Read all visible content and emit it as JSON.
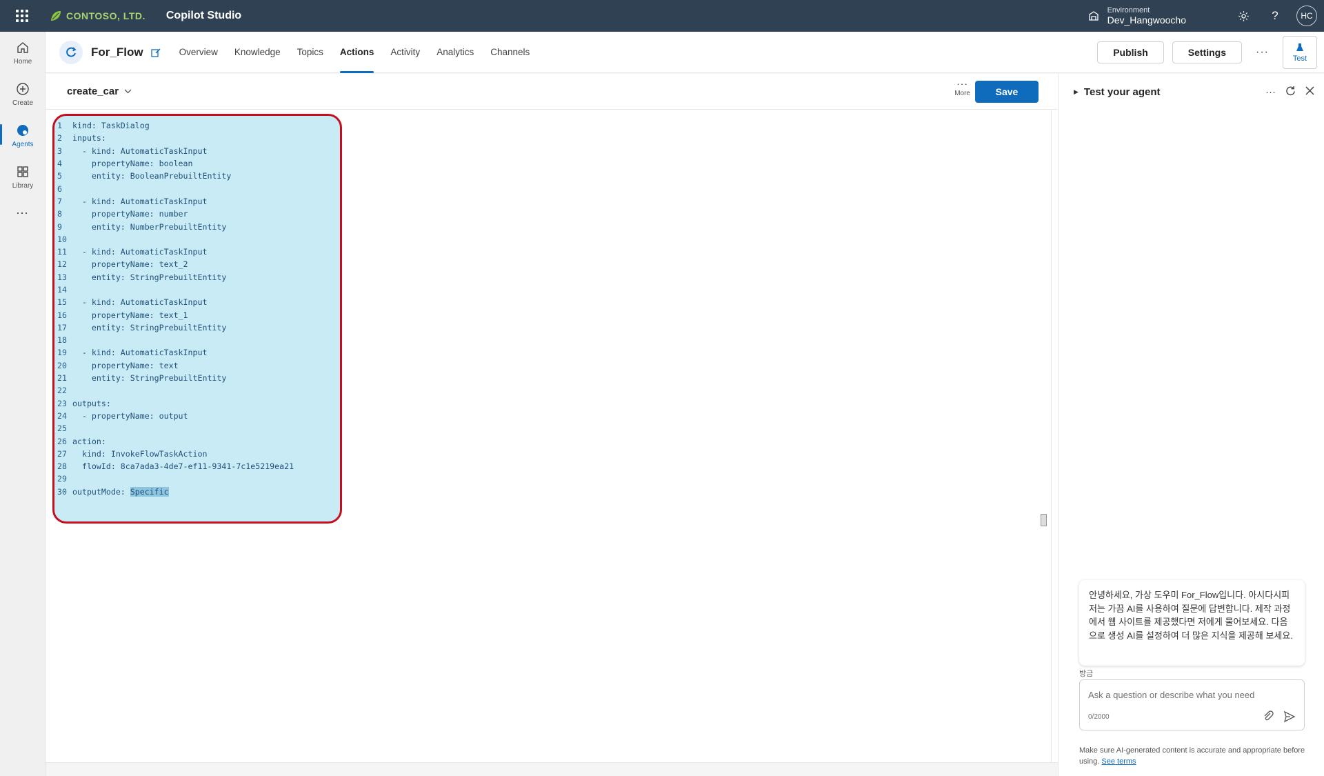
{
  "topbar": {
    "brand": "CONTOSO, LTD.",
    "app_title": "Copilot Studio",
    "environment_label": "Environment",
    "environment_value": "Dev_Hangwoocho",
    "avatar_initials": "HC"
  },
  "rail": {
    "items": [
      {
        "label": "Home",
        "icon": "home-icon"
      },
      {
        "label": "Create",
        "icon": "plus-circle-icon"
      },
      {
        "label": "Agents",
        "icon": "agents-icon",
        "active": true
      },
      {
        "label": "Library",
        "icon": "library-icon"
      }
    ],
    "more": "..."
  },
  "agent": {
    "name": "For_Flow",
    "tabs": [
      "Overview",
      "Knowledge",
      "Topics",
      "Actions",
      "Activity",
      "Analytics",
      "Channels"
    ],
    "active_tab": "Actions",
    "publish_label": "Publish",
    "settings_label": "Settings",
    "more_label": "···",
    "test_label": "Test"
  },
  "editor": {
    "topic_name": "create_car",
    "more_label": "More",
    "save_label": "Save",
    "lines": [
      "kind: TaskDialog",
      "inputs:",
      "  - kind: AutomaticTaskInput",
      "    propertyName: boolean",
      "    entity: BooleanPrebuiltEntity",
      "",
      "  - kind: AutomaticTaskInput",
      "    propertyName: number",
      "    entity: NumberPrebuiltEntity",
      "",
      "  - kind: AutomaticTaskInput",
      "    propertyName: text_2",
      "    entity: StringPrebuiltEntity",
      "",
      "  - kind: AutomaticTaskInput",
      "    propertyName: text_1",
      "    entity: StringPrebuiltEntity",
      "",
      "  - kind: AutomaticTaskInput",
      "    propertyName: text",
      "    entity: StringPrebuiltEntity",
      "",
      "outputs:",
      "  - propertyName: output",
      "",
      "action:",
      "  kind: InvokeFlowTaskAction",
      "  flowId: 8ca7ada3-4de7-ef11-9341-7c1e5219ea21",
      "",
      "outputMode: "
    ],
    "selected_text": "Specific"
  },
  "test_pane": {
    "title": "Test your agent",
    "greeting": "안녕하세요, 가상 도우미 For_Flow입니다. 아시다시피 저는 가끔 AI를 사용하여 질문에 답변합니다. 제작 과정에서 웹 사이트를 제공했다면 저에게 물어보세요. 다음으로 생성 AI를 설정하여 더 많은 지식을 제공해 보세요.",
    "timestamp": "방금",
    "input_placeholder": "Ask a question or describe what you need",
    "counter": "0/2000",
    "disclaimer": "Make sure AI-generated content is accurate and appropriate before using.",
    "see_terms": "See terms"
  }
}
